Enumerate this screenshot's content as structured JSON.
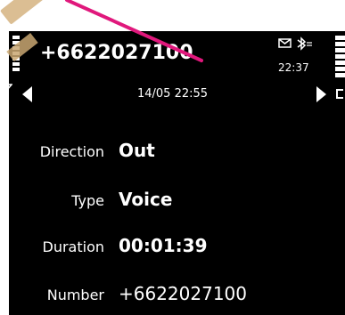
{
  "header": {
    "title": "+6622027100",
    "time": "22:37",
    "status_icons": [
      "envelope-icon",
      "bluetooth-icon"
    ]
  },
  "nav": {
    "date": "14/05 22:55"
  },
  "fields": [
    {
      "label": "Direction",
      "value": "Out"
    },
    {
      "label": "Type",
      "value": "Voice"
    },
    {
      "label": "Duration",
      "value": "00:01:39"
    },
    {
      "label": "Number",
      "value": "+6622027100"
    }
  ],
  "colors": {
    "background": "#000000",
    "text": "#ffffff",
    "annotation": "#e0187c"
  }
}
